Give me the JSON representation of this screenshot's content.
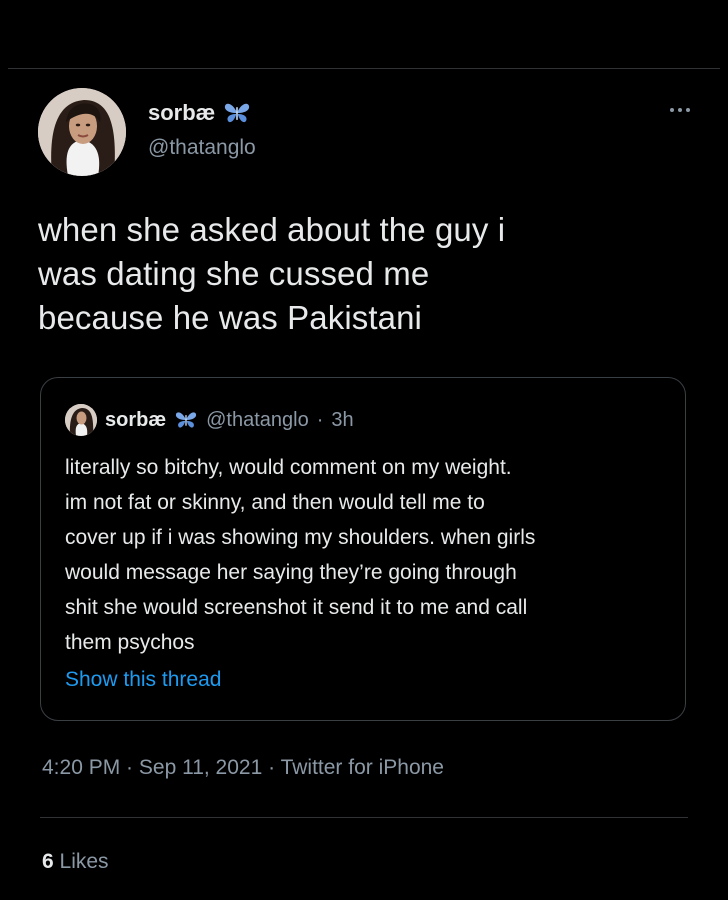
{
  "tweet": {
    "author": {
      "display_name": "sorbæ",
      "handle": "@thatanglo",
      "badge_icon": "butterfly-icon"
    },
    "more_icon": "more-options-icon",
    "text_lines": [
      "when she asked about the guy i",
      "was dating she cussed me",
      "because he was Pakistani"
    ],
    "timestamp": {
      "time": "4:20 PM",
      "date": "Sep 11, 2021",
      "source": "Twitter for iPhone",
      "separator": " · "
    },
    "likes": {
      "count": "6",
      "label": "Likes"
    }
  },
  "quoted_tweet": {
    "display_name": "sorbæ",
    "handle": "@thatanglo",
    "separator": "·",
    "time_ago": "3h",
    "badge_icon": "butterfly-icon",
    "text_lines": [
      "literally so bitchy, would comment on my weight.",
      "im not fat or skinny, and then would tell me to",
      "cover up if i was showing my shoulders. when girls",
      "would message her saying they’re going through",
      "shit she would screenshot it send it to me and call",
      "them psychos"
    ],
    "show_thread_label": "Show this thread"
  },
  "colors": {
    "background": "#000000",
    "primary_text": "#e7e9ea",
    "secondary_text": "#8b98a5",
    "link": "#1d9bf0",
    "border": "#2f3336",
    "butterfly_blue": "#7aa7e8"
  }
}
